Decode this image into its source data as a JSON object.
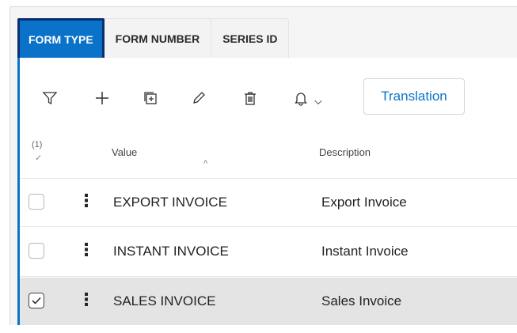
{
  "tabs": [
    {
      "label": "FORM TYPE",
      "active": true
    },
    {
      "label": "FORM NUMBER",
      "active": false
    },
    {
      "label": "SERIES ID",
      "active": false
    }
  ],
  "toolbar": {
    "icons": [
      "filter-icon",
      "add-icon",
      "duplicate-icon",
      "edit-icon",
      "delete-icon",
      "bell-icon",
      "chevron-down-icon"
    ],
    "translation_label": "Translation"
  },
  "table": {
    "selected_count": "(1)",
    "check_mark": "✓",
    "sort_indicator": "^",
    "columns": {
      "value": "Value",
      "description": "Description"
    },
    "rows": [
      {
        "value": "EXPORT INVOICE",
        "description": "Export Invoice",
        "checked": false
      },
      {
        "value": "INSTANT INVOICE",
        "description": "Instant Invoice",
        "checked": false
      },
      {
        "value": "SALES INVOICE",
        "description": "Sales Invoice",
        "checked": true
      }
    ]
  },
  "colors": {
    "accent": "#0a73c9",
    "active_tab_border": "#0b2f6e",
    "selected_row": "#e4e4e4"
  }
}
